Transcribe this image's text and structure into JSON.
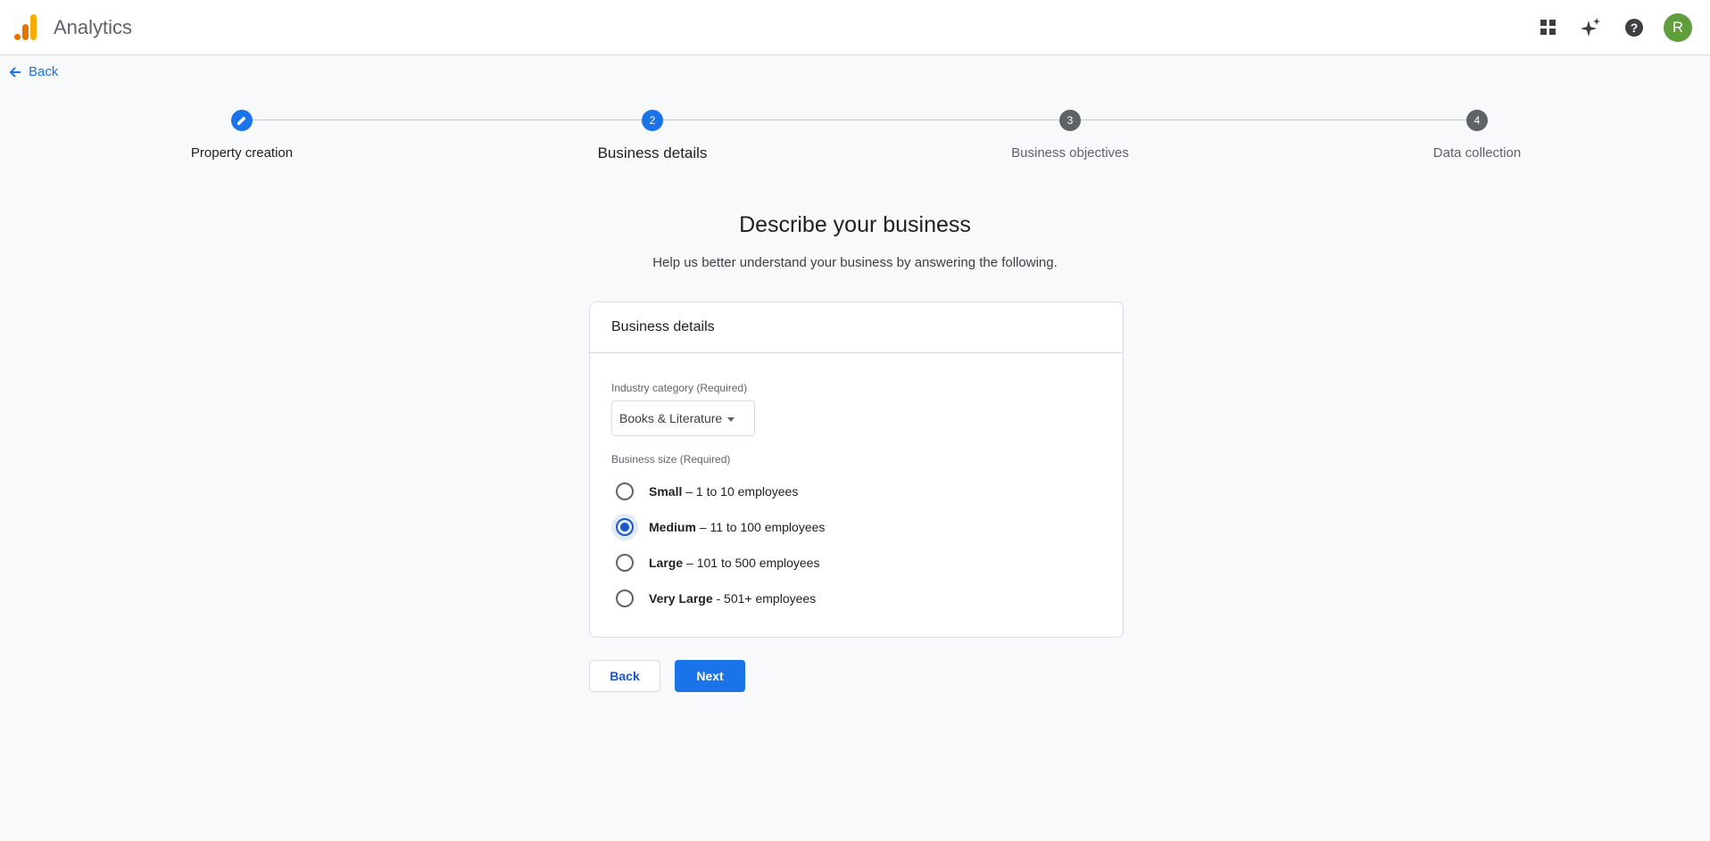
{
  "header": {
    "app_title": "Analytics",
    "icons": [
      "apps-grid-icon",
      "sparkle-icon",
      "help-icon"
    ],
    "avatar_initial": "R",
    "avatar_color": "#5f9e3a"
  },
  "nav": {
    "back_label": "Back"
  },
  "stepper": {
    "steps": [
      {
        "number": "",
        "label": "Property creation",
        "state": "completed"
      },
      {
        "number": "2",
        "label": "Business details",
        "state": "active"
      },
      {
        "number": "3",
        "label": "Business objectives",
        "state": "pending"
      },
      {
        "number": "4",
        "label": "Data collection",
        "state": "pending"
      }
    ]
  },
  "main": {
    "heading": "Describe your business",
    "subheading": "Help us better understand your business by answering the following."
  },
  "card": {
    "title": "Business details",
    "industry_label": "Industry category (Required)",
    "industry_value": "Books & Literature",
    "size_label": "Business size (Required)",
    "size_options": [
      {
        "name": "Small",
        "desc": " – 1 to 10 employees",
        "selected": false
      },
      {
        "name": "Medium",
        "desc": " – 11 to 100 employees",
        "selected": true
      },
      {
        "name": "Large",
        "desc": " – 101 to 500 employees",
        "selected": false
      },
      {
        "name": "Very Large",
        "desc": " - 501+ employees",
        "selected": false
      }
    ]
  },
  "actions": {
    "back_label": "Back",
    "next_label": "Next"
  },
  "colors": {
    "accent": "#1a73e8",
    "selected_radio": "#1a56c4",
    "pending_step": "#5f6368"
  }
}
